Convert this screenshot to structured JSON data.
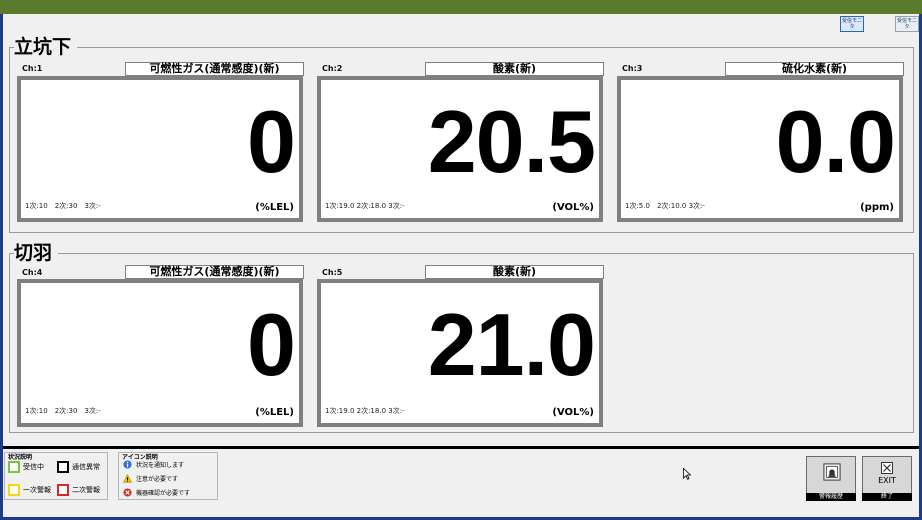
{
  "top_buttons": [
    {
      "label": "受信モニタ",
      "active": true
    },
    {
      "label": "受信モニタ",
      "active": false
    }
  ],
  "groups": [
    {
      "title": "立坑下",
      "channels": [
        {
          "ch": "Ch:1",
          "name": "可燃性ガス(通常感度)(新)",
          "value": "0",
          "unit": "(%LEL)",
          "thresholds": "1次:10　2次:30　3次:-"
        },
        {
          "ch": "Ch:2",
          "name": "酸素(新)",
          "value": "20.5",
          "unit": "(VOL%)",
          "thresholds": "1次:19.0 2次:18.0 3次:-"
        },
        {
          "ch": "Ch:3",
          "name": "硫化水素(新)",
          "value": "0.0",
          "unit": "(ppm)",
          "thresholds": "1次:5.0　2次:10.0 3次:-"
        }
      ]
    },
    {
      "title": "切羽",
      "channels": [
        {
          "ch": "Ch:4",
          "name": "可燃性ガス(通常感度)(新)",
          "value": "0",
          "unit": "(%LEL)",
          "thresholds": "1次:10　2次:30　3次:-"
        },
        {
          "ch": "Ch:5",
          "name": "酸素(新)",
          "value": "21.0",
          "unit": "(VOL%)",
          "thresholds": "1次:19.0 2次:18.0 3次:-"
        }
      ]
    }
  ],
  "status_legend": {
    "title": "状況説明",
    "items": [
      {
        "label": "受信中",
        "color": "#7cc242"
      },
      {
        "label": "通信異常",
        "color": "#000000"
      },
      {
        "label": "一次警報",
        "color": "#f5d90a"
      },
      {
        "label": "二次警報",
        "color": "#d62828"
      }
    ]
  },
  "icon_legend": {
    "title": "アイコン説明",
    "items": [
      {
        "icon": "info-icon",
        "label": "状況を通知します"
      },
      {
        "icon": "warning-icon",
        "label": "注意が必要です"
      },
      {
        "icon": "error-icon",
        "label": "機器確認が必要です"
      }
    ]
  },
  "actions": {
    "history_caption": "警報履歴",
    "exit_text": "EXIT",
    "exit_caption": "終了"
  }
}
